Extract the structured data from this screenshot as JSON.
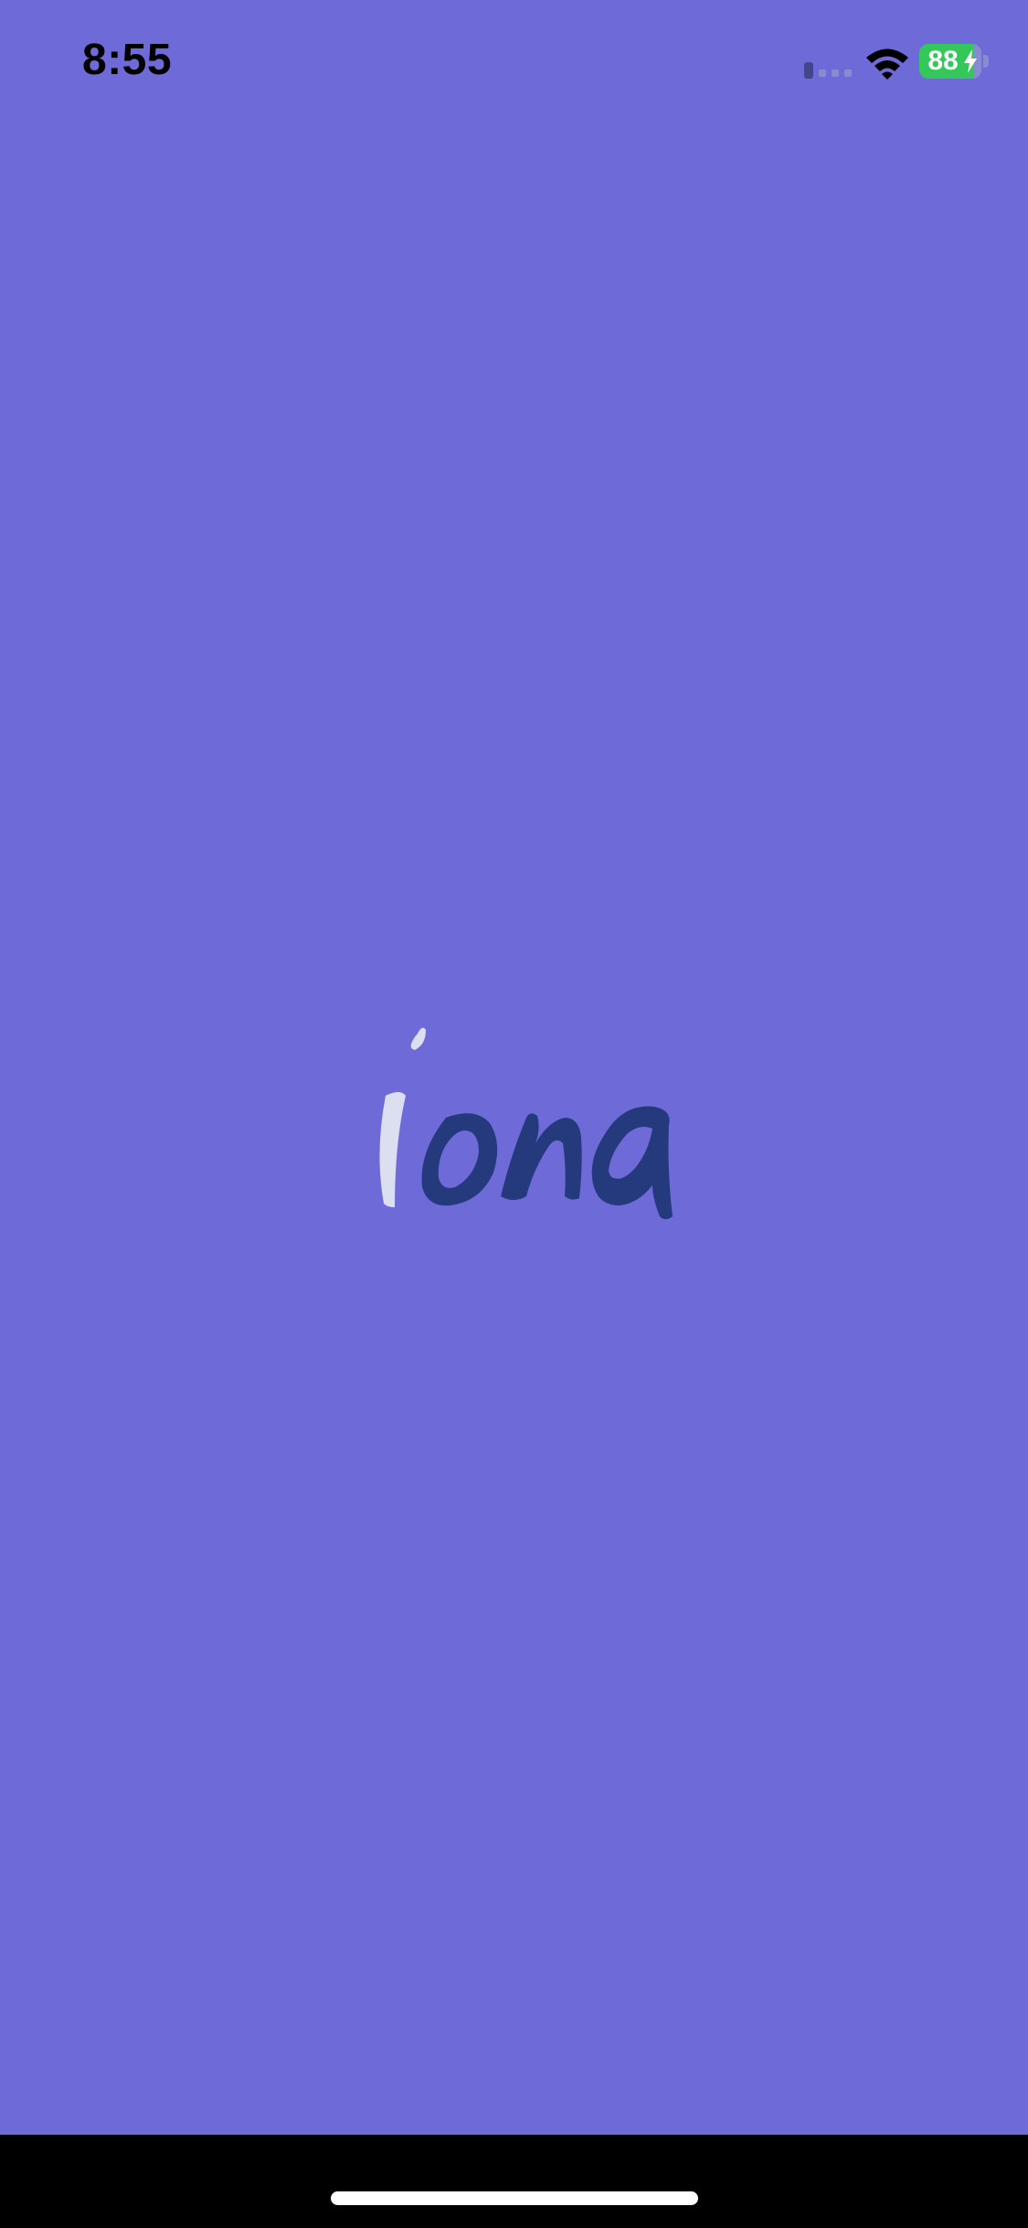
{
  "colors": {
    "background": "#6e6ad8",
    "logo_light": "#dcdff0",
    "logo_dark": "#243a7c",
    "battery_fill": "#34c759"
  },
  "status_bar": {
    "time": "8:55",
    "battery_level": "88",
    "battery_fraction": 0.88,
    "icons": [
      "cell-signal-icon",
      "wifi-icon",
      "battery-icon",
      "bolt-icon"
    ]
  },
  "logo": {
    "text": "iona"
  }
}
